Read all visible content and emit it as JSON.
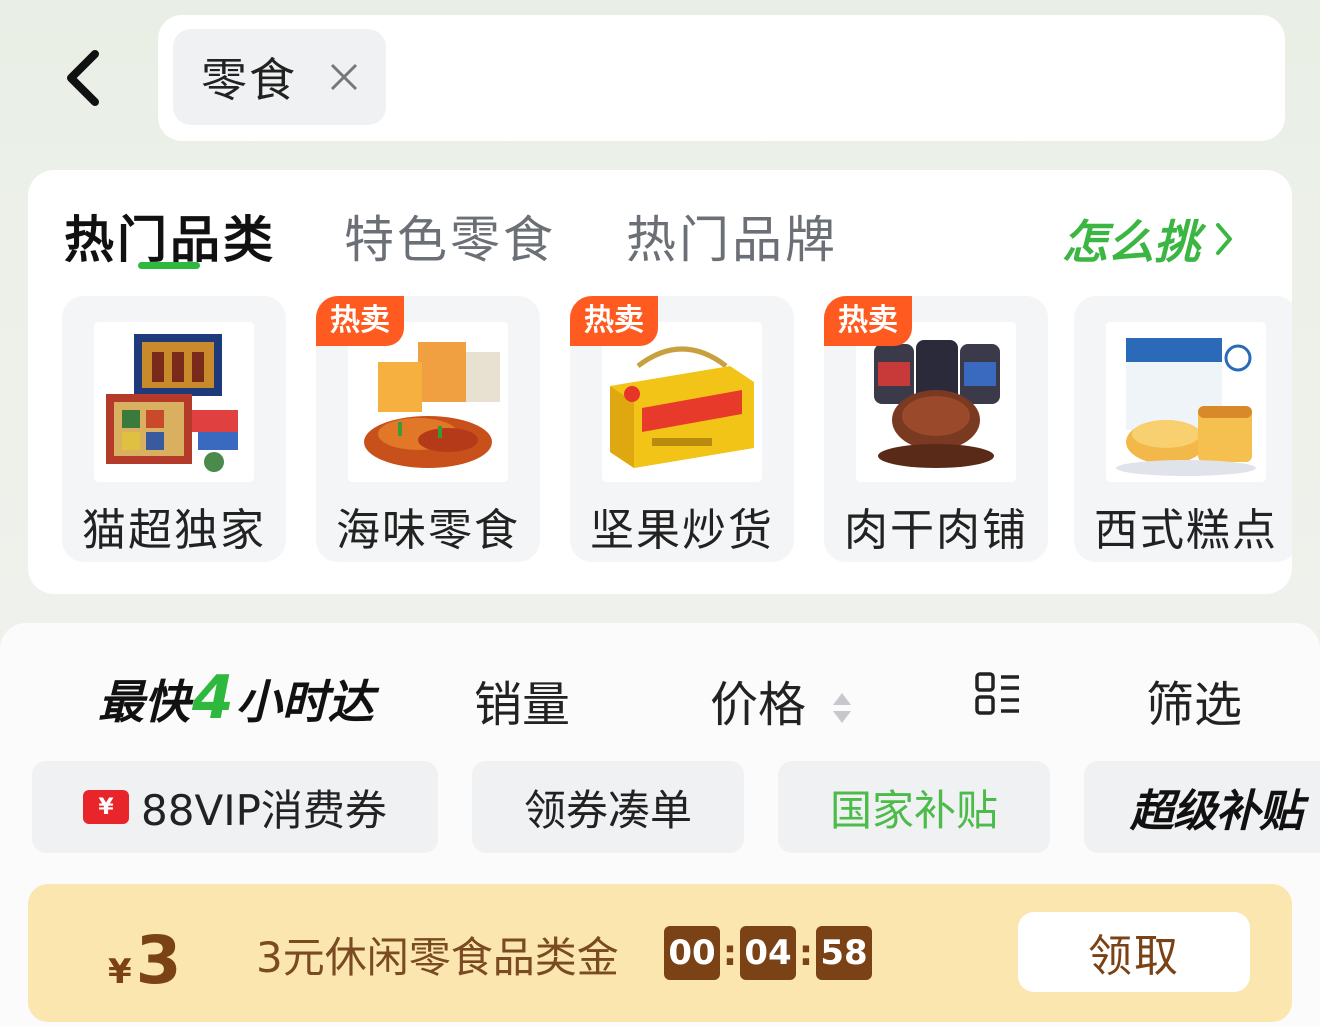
{
  "search": {
    "tag_label": "零食"
  },
  "category_tabs": [
    {
      "label": "热门品类",
      "active": true
    },
    {
      "label": "特色零食",
      "active": false
    },
    {
      "label": "热门品牌",
      "active": false
    }
  ],
  "how_to_pick": "怎么挑",
  "categories": [
    {
      "label": "猫超独家",
      "badge": ""
    },
    {
      "label": "海味零食",
      "badge": "热卖"
    },
    {
      "label": "坚果炒货",
      "badge": "热卖"
    },
    {
      "label": "肉干肉铺",
      "badge": "热卖"
    },
    {
      "label": "西式糕点",
      "badge": ""
    }
  ],
  "sort_bar": {
    "fast_prefix": "最快",
    "fast_number": "4",
    "fast_suffix": "小时达",
    "sales": "销量",
    "price": "价格",
    "filter": "筛选"
  },
  "filter_chips": {
    "vip_coupon": "88VIP消费券",
    "coupon_icon": "¥",
    "collect_coupon": "领券凑单",
    "national_subsidy": "国家补贴",
    "super_subsidy": "超级补贴"
  },
  "banner": {
    "currency": "¥",
    "amount": "3",
    "text": "3元休闲零食品类金",
    "timer_h": "00",
    "timer_m": "04",
    "timer_s": "58",
    "claim": "领取"
  },
  "colors": {
    "accent_green": "#2fb83e",
    "hot_badge": "#ff5a1f",
    "banner_bg": "#fbe6b0",
    "banner_brown": "#7a4215"
  }
}
